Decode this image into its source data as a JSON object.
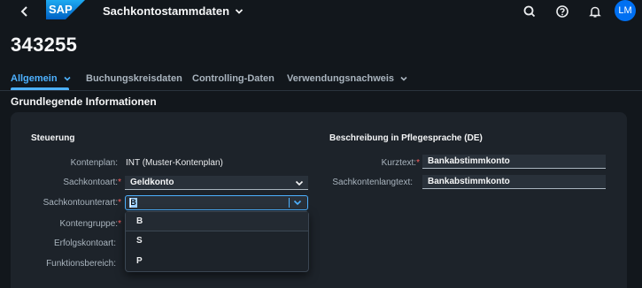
{
  "shell": {
    "logo_text": "SAP",
    "app_title": "Sachkontostammdaten",
    "avatar_initials": "LM",
    "icons": [
      "back-icon",
      "chevron-down-icon",
      "search-icon",
      "help-icon",
      "notification-bell-icon"
    ]
  },
  "object": {
    "id": "343255"
  },
  "tabs": [
    {
      "label": "Allgemein",
      "active": true,
      "has_menu": true
    },
    {
      "label": "Buchungskreisdaten",
      "active": false,
      "has_menu": false
    },
    {
      "label": "Controlling-Daten",
      "active": false,
      "has_menu": false
    },
    {
      "label": "Verwendungsnachweis",
      "active": false,
      "has_menu": true
    }
  ],
  "section": {
    "title": "Grundlegende Informationen"
  },
  "steuerung": {
    "title": "Steuerung",
    "fields": [
      {
        "label": "Kontenplan:",
        "required": false,
        "value": "INT (Muster-Kontenplan)"
      },
      {
        "label": "Sachkontoart:",
        "required": true,
        "value": "Geldkonto"
      },
      {
        "label": "Sachkontounterart:",
        "required": true,
        "value": "B"
      },
      {
        "label": "Kontengruppe:",
        "required": true,
        "value": ""
      },
      {
        "label": "Erfolgskontoart:",
        "required": false,
        "value": ""
      },
      {
        "label": "Funktionsbereich:",
        "required": false,
        "value": ""
      }
    ],
    "dropdown_options": [
      "B",
      "S",
      "P"
    ]
  },
  "beschreibung": {
    "title": "Beschreibung in Pflegesprache (DE)",
    "fields": [
      {
        "label": "Kurztext:",
        "required": true,
        "value": "Bankabstimmkonto"
      },
      {
        "label": "Sachkontenlangtext:",
        "required": false,
        "value": "Bankabstimmkonto"
      }
    ]
  },
  "colors": {
    "background": "#12171c",
    "card": "#1d232a",
    "accent": "#4db1ff",
    "required": "#ff5f5f",
    "avatar": "#0070f2"
  }
}
